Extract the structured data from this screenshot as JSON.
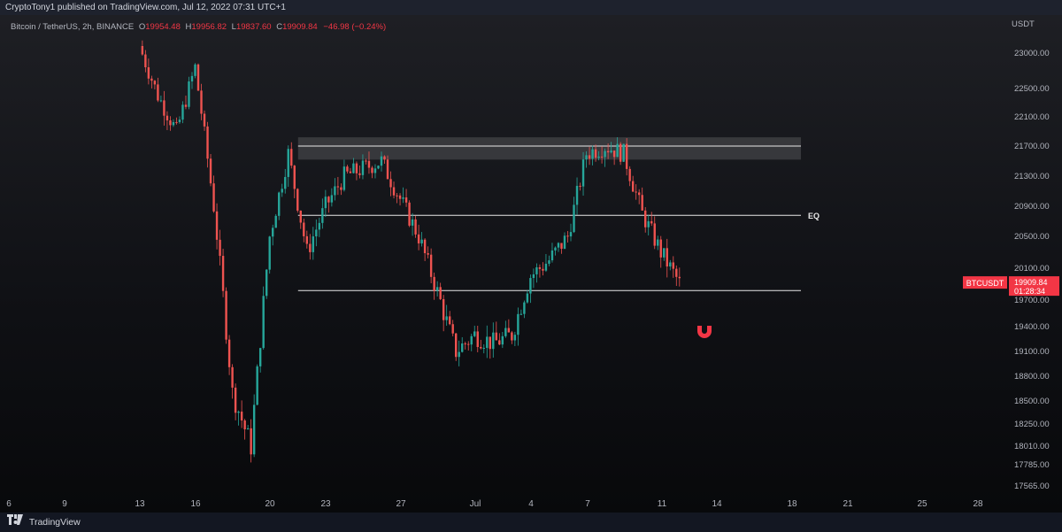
{
  "header": {
    "published": "CryptoTony1 published on TradingView.com, Jul 12, 2022 07:31 UTC+1"
  },
  "legend": {
    "symbol": "Bitcoin / TetherUS, 2h, BINANCE",
    "o_label": "O",
    "o": "19954.48",
    "h_label": "H",
    "h": "19956.82",
    "l_label": "L",
    "l": "19837.60",
    "c_label": "C",
    "c": "19909.84",
    "change": "−46.98 (−0.24%)"
  },
  "price_axis": {
    "currency": "USDT"
  },
  "last_price": {
    "ticker": "BTCUSDT",
    "price": "19909.84",
    "countdown": "01:28:34"
  },
  "annotations": {
    "eq_label": "EQ",
    "magnet_icon": "magnet-icon"
  },
  "footer": {
    "brand": "TradingView"
  },
  "colors": {
    "up": "#26a69a",
    "down": "#ef5350",
    "accent": "#f23645",
    "background": "#131722"
  },
  "chart_data": {
    "type": "candlestick",
    "symbol": "BTCUSDT",
    "interval": "2h",
    "x_ticks": [
      "6",
      "9",
      "13",
      "16",
      "20",
      "23",
      "27",
      "Jul",
      "4",
      "7",
      "11",
      "14",
      "18",
      "21",
      "25",
      "28"
    ],
    "y_ticks": [
      23000,
      22500,
      22100,
      21700,
      21300,
      20900,
      20500,
      20100,
      19700,
      19400,
      19100,
      18800,
      18500,
      18250,
      18010,
      17785,
      17565
    ],
    "price_path": [
      {
        "date": "Jun 13",
        "price": 23100
      },
      {
        "date": "Jun 14",
        "price": 22400
      },
      {
        "date": "Jun 15",
        "price": 21900
      },
      {
        "date": "Jun 16",
        "price": 22800
      },
      {
        "date": "Jun 17",
        "price": 20900
      },
      {
        "date": "Jun 18",
        "price": 18600
      },
      {
        "date": "Jun 19",
        "price": 18000
      },
      {
        "date": "Jun 20",
        "price": 20500
      },
      {
        "date": "Jun 21",
        "price": 21600
      },
      {
        "date": "Jun 22",
        "price": 20300
      },
      {
        "date": "Jun 23",
        "price": 20900
      },
      {
        "date": "Jun 24",
        "price": 21300
      },
      {
        "date": "Jun 26",
        "price": 21500
      },
      {
        "date": "Jun 27",
        "price": 21000
      },
      {
        "date": "Jun 28",
        "price": 20500
      },
      {
        "date": "Jun 30",
        "price": 19100
      },
      {
        "date": "Jul 1",
        "price": 19300
      },
      {
        "date": "Jul 2",
        "price": 19200
      },
      {
        "date": "Jul 3",
        "price": 19300
      },
      {
        "date": "Jul 4",
        "price": 20000
      },
      {
        "date": "Jul 5",
        "price": 20200
      },
      {
        "date": "Jul 6",
        "price": 20500
      },
      {
        "date": "Jul 7",
        "price": 21600
      },
      {
        "date": "Jul 8",
        "price": 21700
      },
      {
        "date": "Jul 9",
        "price": 21600
      },
      {
        "date": "Jul 10",
        "price": 20800
      },
      {
        "date": "Jul 11",
        "price": 20300
      },
      {
        "date": "Jul 12",
        "price": 19910
      }
    ],
    "levels": [
      {
        "name": "resistance-zone",
        "from": 21520,
        "to": 21820,
        "top_line": 21700
      },
      {
        "name": "EQ",
        "price": 20780
      },
      {
        "name": "support",
        "price": 19820
      }
    ],
    "last": {
      "price": 19909.84,
      "open": 19954.48,
      "high": 19956.82,
      "low": 19837.6,
      "change": -46.98,
      "change_pct": -0.24
    }
  }
}
